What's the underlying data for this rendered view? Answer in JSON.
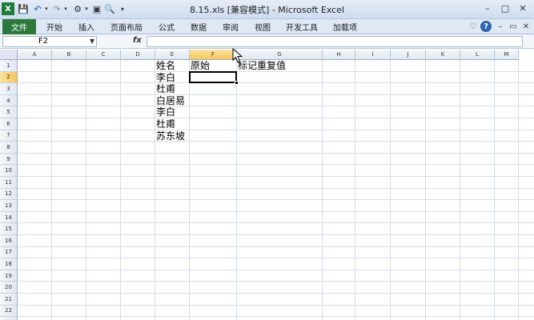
{
  "window": {
    "title": "8.15.xls  [兼容模式]  -  Microsoft Excel",
    "minimize": "–",
    "restore": "□",
    "close": "✕"
  },
  "ribbon": {
    "file_tab": "文件",
    "tabs": [
      "开始",
      "插入",
      "页面布局",
      "公式",
      "数据",
      "审阅",
      "视图",
      "开发工具",
      "加载项"
    ]
  },
  "formula_bar": {
    "name_box": "F2",
    "fx": "fx",
    "content": ""
  },
  "sheet": {
    "columns": [
      "A",
      "B",
      "C",
      "D",
      "E",
      "F",
      "G",
      "H",
      "I",
      "J",
      "K",
      "L",
      "M"
    ],
    "rows": [
      "1",
      "2",
      "3",
      "4",
      "5",
      "6",
      "7",
      "8",
      "9",
      "10",
      "11",
      "12",
      "13",
      "14",
      "15",
      "16",
      "17",
      "18",
      "19",
      "20",
      "21",
      "22",
      "23"
    ],
    "selected_column": "F",
    "selected_row": "2",
    "cells": {
      "E1": "姓名",
      "F1": "原始",
      "G1": "标记重复值",
      "E2": "李白",
      "E3": "杜甫",
      "E4": "白居易",
      "E5": "李白",
      "E6": "杜甫",
      "E7": "苏东坡"
    }
  }
}
